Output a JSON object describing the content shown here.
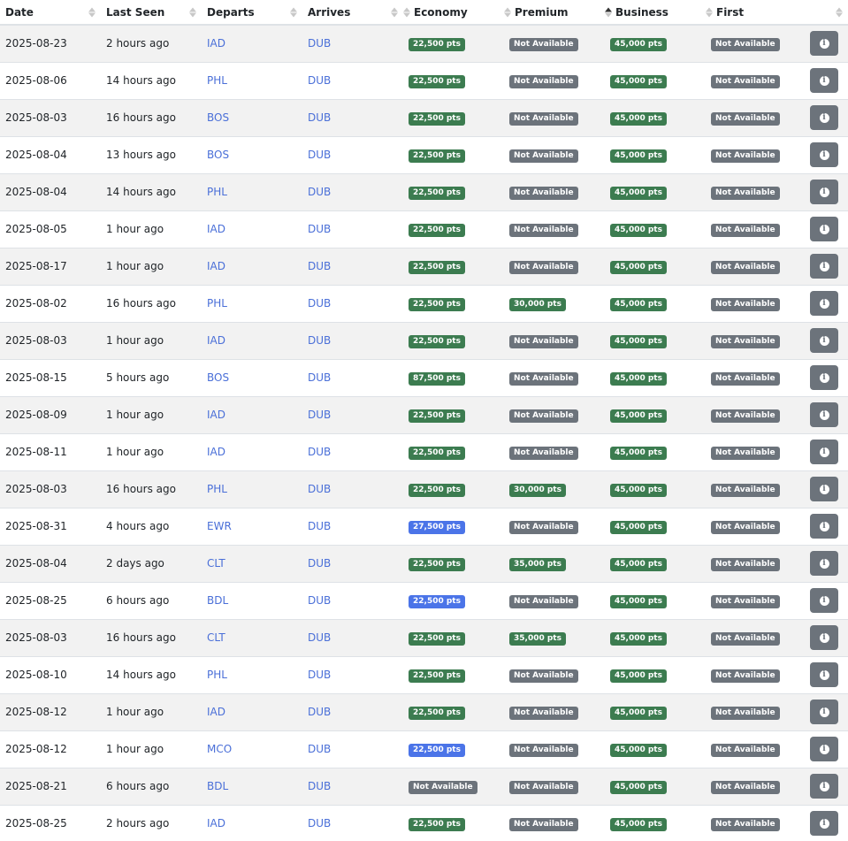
{
  "headers": {
    "date": "Date",
    "last_seen": "Last Seen",
    "departs": "Departs",
    "arrives": "Arrives",
    "economy": "Economy",
    "premium": "Premium",
    "business": "Business",
    "first": "First"
  },
  "sort": {
    "active_column": "business",
    "direction": "asc"
  },
  "colors": {
    "badge_green": "#3c7c50",
    "badge_gray": "#6c737b",
    "badge_blue": "#4b74e8",
    "link": "#4a6fd8"
  },
  "icons": {
    "action": "info-icon",
    "sort": "sort-arrows-icon"
  },
  "rows": [
    {
      "date": "2025-08-23",
      "seen": "2 hours ago",
      "dep": "IAD",
      "arr": "DUB",
      "eco": {
        "t": "22,500 pts",
        "c": "green"
      },
      "pre": {
        "t": "Not Available",
        "c": "gray"
      },
      "bus": {
        "t": "45,000 pts",
        "c": "green"
      },
      "fir": {
        "t": "Not Available",
        "c": "gray"
      }
    },
    {
      "date": "2025-08-06",
      "seen": "14 hours ago",
      "dep": "PHL",
      "arr": "DUB",
      "eco": {
        "t": "22,500 pts",
        "c": "green"
      },
      "pre": {
        "t": "Not Available",
        "c": "gray"
      },
      "bus": {
        "t": "45,000 pts",
        "c": "green"
      },
      "fir": {
        "t": "Not Available",
        "c": "gray"
      }
    },
    {
      "date": "2025-08-03",
      "seen": "16 hours ago",
      "dep": "BOS",
      "arr": "DUB",
      "eco": {
        "t": "22,500 pts",
        "c": "green"
      },
      "pre": {
        "t": "Not Available",
        "c": "gray"
      },
      "bus": {
        "t": "45,000 pts",
        "c": "green"
      },
      "fir": {
        "t": "Not Available",
        "c": "gray"
      }
    },
    {
      "date": "2025-08-04",
      "seen": "13 hours ago",
      "dep": "BOS",
      "arr": "DUB",
      "eco": {
        "t": "22,500 pts",
        "c": "green"
      },
      "pre": {
        "t": "Not Available",
        "c": "gray"
      },
      "bus": {
        "t": "45,000 pts",
        "c": "green"
      },
      "fir": {
        "t": "Not Available",
        "c": "gray"
      }
    },
    {
      "date": "2025-08-04",
      "seen": "14 hours ago",
      "dep": "PHL",
      "arr": "DUB",
      "eco": {
        "t": "22,500 pts",
        "c": "green"
      },
      "pre": {
        "t": "Not Available",
        "c": "gray"
      },
      "bus": {
        "t": "45,000 pts",
        "c": "green"
      },
      "fir": {
        "t": "Not Available",
        "c": "gray"
      }
    },
    {
      "date": "2025-08-05",
      "seen": "1 hour ago",
      "dep": "IAD",
      "arr": "DUB",
      "eco": {
        "t": "22,500 pts",
        "c": "green"
      },
      "pre": {
        "t": "Not Available",
        "c": "gray"
      },
      "bus": {
        "t": "45,000 pts",
        "c": "green"
      },
      "fir": {
        "t": "Not Available",
        "c": "gray"
      }
    },
    {
      "date": "2025-08-17",
      "seen": "1 hour ago",
      "dep": "IAD",
      "arr": "DUB",
      "eco": {
        "t": "22,500 pts",
        "c": "green"
      },
      "pre": {
        "t": "Not Available",
        "c": "gray"
      },
      "bus": {
        "t": "45,000 pts",
        "c": "green"
      },
      "fir": {
        "t": "Not Available",
        "c": "gray"
      }
    },
    {
      "date": "2025-08-02",
      "seen": "16 hours ago",
      "dep": "PHL",
      "arr": "DUB",
      "eco": {
        "t": "22,500 pts",
        "c": "green"
      },
      "pre": {
        "t": "30,000 pts",
        "c": "green"
      },
      "bus": {
        "t": "45,000 pts",
        "c": "green"
      },
      "fir": {
        "t": "Not Available",
        "c": "gray"
      }
    },
    {
      "date": "2025-08-03",
      "seen": "1 hour ago",
      "dep": "IAD",
      "arr": "DUB",
      "eco": {
        "t": "22,500 pts",
        "c": "green"
      },
      "pre": {
        "t": "Not Available",
        "c": "gray"
      },
      "bus": {
        "t": "45,000 pts",
        "c": "green"
      },
      "fir": {
        "t": "Not Available",
        "c": "gray"
      }
    },
    {
      "date": "2025-08-15",
      "seen": "5 hours ago",
      "dep": "BOS",
      "arr": "DUB",
      "eco": {
        "t": "87,500 pts",
        "c": "green"
      },
      "pre": {
        "t": "Not Available",
        "c": "gray"
      },
      "bus": {
        "t": "45,000 pts",
        "c": "green"
      },
      "fir": {
        "t": "Not Available",
        "c": "gray"
      }
    },
    {
      "date": "2025-08-09",
      "seen": "1 hour ago",
      "dep": "IAD",
      "arr": "DUB",
      "eco": {
        "t": "22,500 pts",
        "c": "green"
      },
      "pre": {
        "t": "Not Available",
        "c": "gray"
      },
      "bus": {
        "t": "45,000 pts",
        "c": "green"
      },
      "fir": {
        "t": "Not Available",
        "c": "gray"
      }
    },
    {
      "date": "2025-08-11",
      "seen": "1 hour ago",
      "dep": "IAD",
      "arr": "DUB",
      "eco": {
        "t": "22,500 pts",
        "c": "green"
      },
      "pre": {
        "t": "Not Available",
        "c": "gray"
      },
      "bus": {
        "t": "45,000 pts",
        "c": "green"
      },
      "fir": {
        "t": "Not Available",
        "c": "gray"
      }
    },
    {
      "date": "2025-08-03",
      "seen": "16 hours ago",
      "dep": "PHL",
      "arr": "DUB",
      "eco": {
        "t": "22,500 pts",
        "c": "green"
      },
      "pre": {
        "t": "30,000 pts",
        "c": "green"
      },
      "bus": {
        "t": "45,000 pts",
        "c": "green"
      },
      "fir": {
        "t": "Not Available",
        "c": "gray"
      }
    },
    {
      "date": "2025-08-31",
      "seen": "4 hours ago",
      "dep": "EWR",
      "arr": "DUB",
      "eco": {
        "t": "27,500 pts",
        "c": "blue"
      },
      "pre": {
        "t": "Not Available",
        "c": "gray"
      },
      "bus": {
        "t": "45,000 pts",
        "c": "green"
      },
      "fir": {
        "t": "Not Available",
        "c": "gray"
      }
    },
    {
      "date": "2025-08-04",
      "seen": "2 days ago",
      "dep": "CLT",
      "arr": "DUB",
      "eco": {
        "t": "22,500 pts",
        "c": "green"
      },
      "pre": {
        "t": "35,000 pts",
        "c": "green"
      },
      "bus": {
        "t": "45,000 pts",
        "c": "green"
      },
      "fir": {
        "t": "Not Available",
        "c": "gray"
      }
    },
    {
      "date": "2025-08-25",
      "seen": "6 hours ago",
      "dep": "BDL",
      "arr": "DUB",
      "eco": {
        "t": "22,500 pts",
        "c": "blue"
      },
      "pre": {
        "t": "Not Available",
        "c": "gray"
      },
      "bus": {
        "t": "45,000 pts",
        "c": "green"
      },
      "fir": {
        "t": "Not Available",
        "c": "gray"
      }
    },
    {
      "date": "2025-08-03",
      "seen": "16 hours ago",
      "dep": "CLT",
      "arr": "DUB",
      "eco": {
        "t": "22,500 pts",
        "c": "green"
      },
      "pre": {
        "t": "35,000 pts",
        "c": "green"
      },
      "bus": {
        "t": "45,000 pts",
        "c": "green"
      },
      "fir": {
        "t": "Not Available",
        "c": "gray"
      }
    },
    {
      "date": "2025-08-10",
      "seen": "14 hours ago",
      "dep": "PHL",
      "arr": "DUB",
      "eco": {
        "t": "22,500 pts",
        "c": "green"
      },
      "pre": {
        "t": "Not Available",
        "c": "gray"
      },
      "bus": {
        "t": "45,000 pts",
        "c": "green"
      },
      "fir": {
        "t": "Not Available",
        "c": "gray"
      }
    },
    {
      "date": "2025-08-12",
      "seen": "1 hour ago",
      "dep": "IAD",
      "arr": "DUB",
      "eco": {
        "t": "22,500 pts",
        "c": "green"
      },
      "pre": {
        "t": "Not Available",
        "c": "gray"
      },
      "bus": {
        "t": "45,000 pts",
        "c": "green"
      },
      "fir": {
        "t": "Not Available",
        "c": "gray"
      }
    },
    {
      "date": "2025-08-12",
      "seen": "1 hour ago",
      "dep": "MCO",
      "arr": "DUB",
      "eco": {
        "t": "22,500 pts",
        "c": "blue"
      },
      "pre": {
        "t": "Not Available",
        "c": "gray"
      },
      "bus": {
        "t": "45,000 pts",
        "c": "green"
      },
      "fir": {
        "t": "Not Available",
        "c": "gray"
      }
    },
    {
      "date": "2025-08-21",
      "seen": "6 hours ago",
      "dep": "BDL",
      "arr": "DUB",
      "eco": {
        "t": "Not Available",
        "c": "gray"
      },
      "pre": {
        "t": "Not Available",
        "c": "gray"
      },
      "bus": {
        "t": "45,000 pts",
        "c": "green"
      },
      "fir": {
        "t": "Not Available",
        "c": "gray"
      }
    },
    {
      "date": "2025-08-25",
      "seen": "2 hours ago",
      "dep": "IAD",
      "arr": "DUB",
      "eco": {
        "t": "22,500 pts",
        "c": "green"
      },
      "pre": {
        "t": "Not Available",
        "c": "gray"
      },
      "bus": {
        "t": "45,000 pts",
        "c": "green"
      },
      "fir": {
        "t": "Not Available",
        "c": "gray"
      }
    }
  ]
}
